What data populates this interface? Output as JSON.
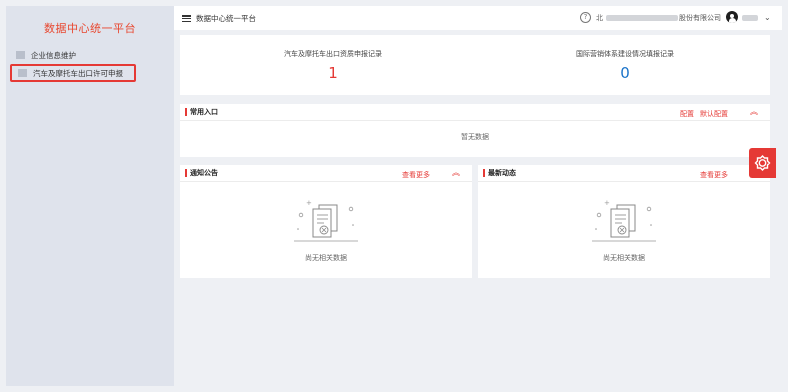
{
  "sidebar": {
    "title": "数据中心统一平台",
    "items": [
      {
        "label": "企业信息维护",
        "active": false
      },
      {
        "label": "汽车及摩托车出口许可申报",
        "active": true
      }
    ]
  },
  "header": {
    "app_title": "数据中心统一平台",
    "company_prefix": "北",
    "company_suffix": "股份有限公司",
    "icons": [
      "menu-icon",
      "help-icon",
      "user-icon",
      "chevron-down-icon"
    ]
  },
  "stats": [
    {
      "label": "汽车及摩托车出口资质申报记录",
      "value": "1",
      "color": "#e53935"
    },
    {
      "label": "国际营销体系建设情况填报记录",
      "value": "0",
      "color": "#1a73c9"
    }
  ],
  "quick_entry": {
    "title": "常用入口",
    "config_label": "配置",
    "default_config_label": "默认配置",
    "empty_text": "暂无数据"
  },
  "notices": {
    "title": "通知公告",
    "more_label": "查看更多",
    "empty_text": "尚无相关数据"
  },
  "news": {
    "title": "最新动态",
    "more_label": "查看更多",
    "empty_text": "尚无相关数据"
  },
  "colors": {
    "accent": "#e53935",
    "sidebar_bg": "#dfe3ec",
    "page_bg": "#eef0f4"
  }
}
